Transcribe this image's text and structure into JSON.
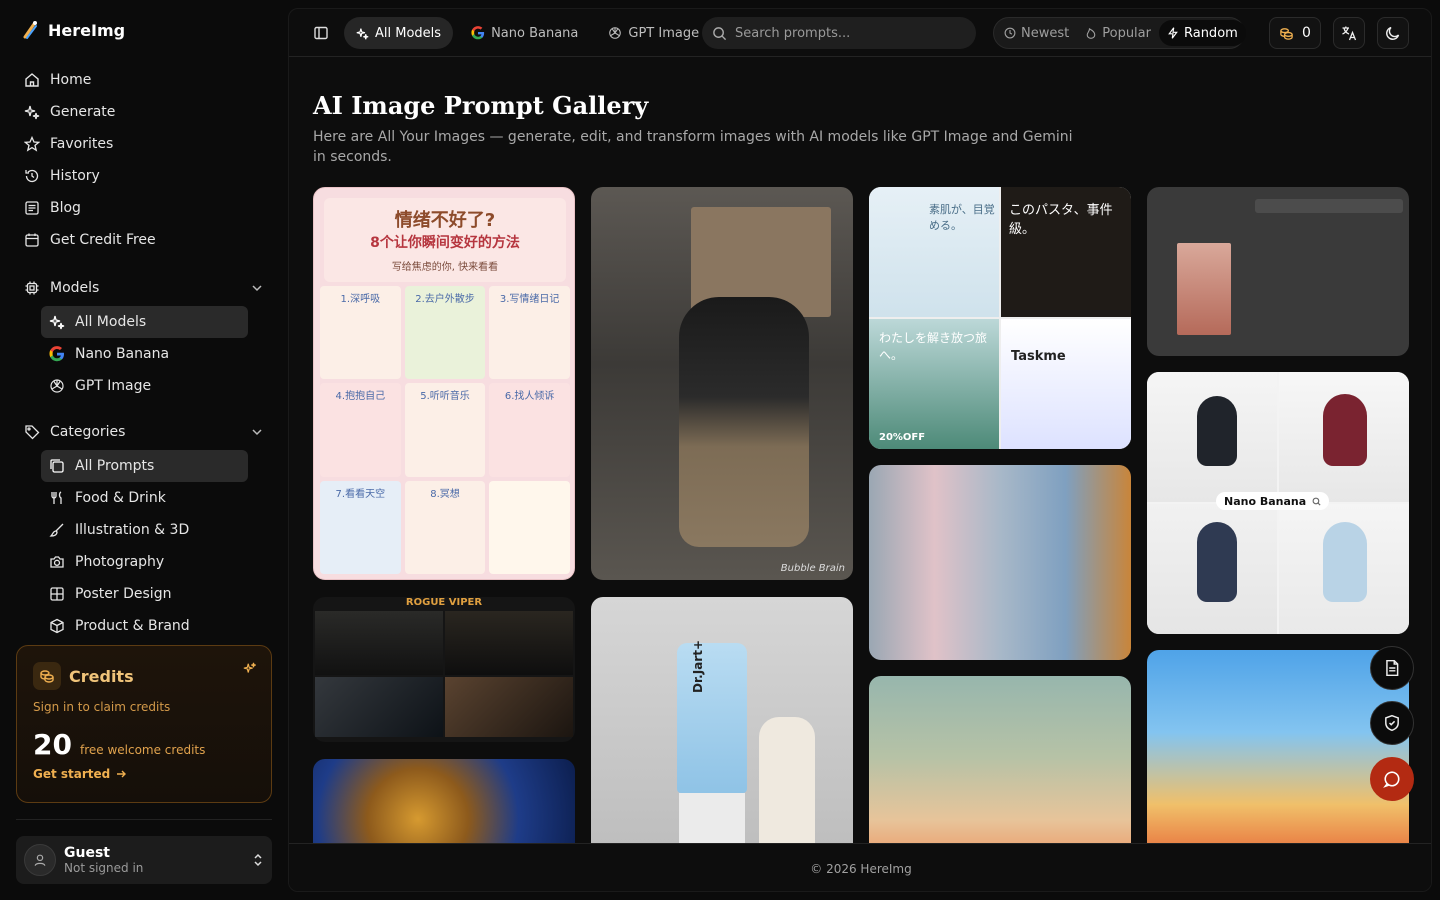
{
  "brand": {
    "name": "HereImg"
  },
  "nav": [
    {
      "label": "Home",
      "icon": "home-icon"
    },
    {
      "label": "Generate",
      "icon": "sparkles-icon"
    },
    {
      "label": "Favorites",
      "icon": "star-icon"
    },
    {
      "label": "History",
      "icon": "history-icon"
    },
    {
      "label": "Blog",
      "icon": "newspaper-icon"
    },
    {
      "label": "Get Credit Free",
      "icon": "calendar-icon"
    }
  ],
  "models": {
    "label": "Models",
    "items": [
      {
        "label": "All Models",
        "icon": "sparkles-icon",
        "active": true
      },
      {
        "label": "Nano Banana",
        "icon": "google-icon"
      },
      {
        "label": "GPT Image",
        "icon": "openai-icon"
      }
    ]
  },
  "categories": {
    "label": "Categories",
    "items": [
      {
        "label": "All Prompts",
        "icon": "gallery-icon",
        "active": true
      },
      {
        "label": "Food & Drink",
        "icon": "utensils-icon"
      },
      {
        "label": "Illustration & 3D",
        "icon": "brush-icon"
      },
      {
        "label": "Photography",
        "icon": "camera-icon"
      },
      {
        "label": "Poster Design",
        "icon": "grid-icon"
      },
      {
        "label": "Product & Brand",
        "icon": "box-icon"
      }
    ]
  },
  "credits": {
    "title": "Credits",
    "signin": "Sign in to claim credits",
    "amount": "20",
    "amount_text": "free welcome credits",
    "cta": "Get started"
  },
  "user": {
    "name": "Guest",
    "status": "Not signed in"
  },
  "topbar": {
    "tabs": [
      "All Models",
      "Nano Banana",
      "GPT Image"
    ],
    "search_placeholder": "Search prompts...",
    "sort": [
      "Newest",
      "Popular",
      "Random"
    ],
    "active_sort": "Random",
    "credit_count": "0"
  },
  "page": {
    "title": "AI Image Prompt Gallery",
    "subtitle": "Here are All Your Images — generate, edit, and transform images with AI models like GPT Image and Gemini in seconds."
  },
  "gallery": {
    "card1": {
      "title": "情绪不好了?",
      "subtitle": "8个让你瞬间变好的方法",
      "caption": "写给焦虑的你, 快来看看",
      "tips": [
        "1.深呼吸",
        "2.去户外散步",
        "3.写情绪日记",
        "4.抱抱自己",
        "5.听听音乐",
        "6.找人倾诉",
        "7.看看天空",
        "8.冥想",
        ""
      ]
    },
    "card2": {
      "signature": "Bubble Brain"
    },
    "card3": {
      "t1": "素肌が、目覚める。",
      "t2": "このパスタ、事件級。",
      "t3": "わたしを解き放つ旅へ。",
      "t4": "Taskme",
      "t5": "20%OFF"
    },
    "card5": {
      "title": "ROGUE VIPER"
    },
    "card6": {
      "brand": "Dr.Jart+"
    },
    "card8": {
      "chip": "Nano Banana"
    }
  },
  "colors": {
    "accent": "#f0b050",
    "fab_red": "#b32a12"
  },
  "footer": {
    "text": "© 2026 HereImg"
  }
}
